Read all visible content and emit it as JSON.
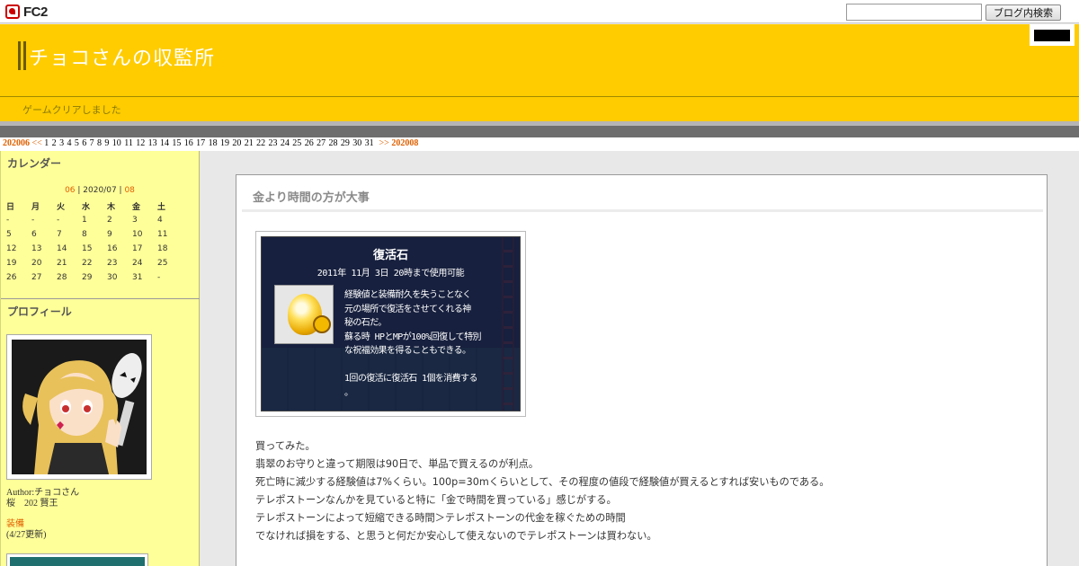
{
  "fc2bar": {
    "logo_text": "FC2",
    "search_placeholder": "",
    "search_button": "ブログ内検索"
  },
  "header": {
    "title": "チョコさんの収監所",
    "description": "ゲームクリアしました"
  },
  "datenav": {
    "prev_month": "202006",
    "prev_arrow": "<<",
    "days": [
      "1",
      "2",
      "3",
      "4",
      "5",
      "6",
      "7",
      "8",
      "9",
      "10",
      "11",
      "12",
      "13",
      "14",
      "15",
      "16",
      "17",
      "18",
      "19",
      "20",
      "21",
      "22",
      "23",
      "24",
      "25",
      "26",
      "27",
      "28",
      "29",
      "30",
      "31"
    ],
    "next_arrow": ">>",
    "next_month": "202008"
  },
  "sidebar": {
    "calendar": {
      "heading": "カレンダー",
      "prev": "06",
      "sep1": " | ",
      "current": "2020/07",
      "sep2": " | ",
      "next": "08",
      "weekdays": [
        "日",
        "月",
        "火",
        "水",
        "木",
        "金",
        "土"
      ],
      "weeks": [
        [
          "-",
          "-",
          "-",
          "1",
          "2",
          "3",
          "4"
        ],
        [
          "5",
          "6",
          "7",
          "8",
          "9",
          "10",
          "11"
        ],
        [
          "12",
          "13",
          "14",
          "15",
          "16",
          "17",
          "18"
        ],
        [
          "19",
          "20",
          "21",
          "22",
          "23",
          "24",
          "25"
        ],
        [
          "26",
          "27",
          "28",
          "29",
          "30",
          "31",
          "-"
        ]
      ]
    },
    "profile": {
      "heading": "プロフィール",
      "author_line": "Author:チョコさん",
      "sub_line": "桜　202 賢王",
      "equip_link": "装備",
      "equip_date": "(4/27更新)"
    }
  },
  "entry": {
    "title": "金より時間の方が大事",
    "screenshot": {
      "item_name": "復活石",
      "item_date": "2011年 11月 3日 20時まで使用可能",
      "desc_lines": [
        "経験値と装備耐久を失うことなく",
        "元の場所で復活をさせてくれる神",
        "秘の石だ。",
        "蘇る時 HPとMPが100%回復して特別",
        "な祝福効果を得ることもできる。",
        "",
        "1回の復活に復活石 1個を消費する",
        "。"
      ]
    },
    "paragraphs": [
      "買ってみた。",
      "翡翠のお守りと違って期限は90日で、単品で買えるのが利点。",
      "死亡時に減少する経験値は7%くらい。100p=30mくらいとして、その程度の値段で経験値が買えるとすれば安いものである。",
      "テレポストーンなんかを見ていると特に「金で時間を買っている」感じがする。",
      "テレポストーンによって短縮できる時間＞テレポストーンの代金を稼ぐための時間",
      "でなければ損をする、と思うと何だか安心して使えないのでテレポストーンは買わない。"
    ]
  },
  "colors": {
    "header_bg": "#ffcc00",
    "sidebar_bg": "#ffff99",
    "accent_orange": "#e06000"
  }
}
